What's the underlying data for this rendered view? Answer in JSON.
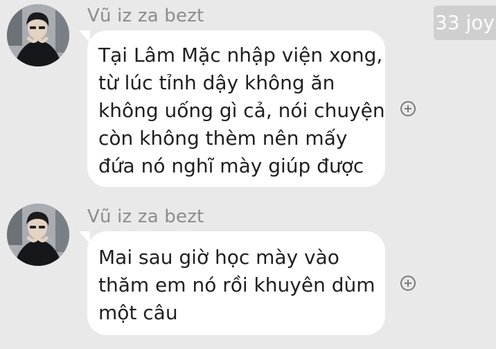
{
  "watermark": "33 joy",
  "messages": [
    {
      "sender": "Vũ iz za bezt",
      "lines": [
        "Tại Lâm Mặc nhập viện xong,",
        "từ lúc tỉnh dậy không ăn",
        "không uống gì cả, nói chuyện",
        "còn không thèm nên mấy",
        "đứa nó nghĩ mày giúp được"
      ]
    },
    {
      "sender": "Vũ iz za bezt",
      "lines": [
        "Mai sau giờ học mày vào",
        "thăm em nó rồi khuyên dùm",
        "một câu"
      ]
    }
  ],
  "icons": {
    "avatar": "avatar",
    "react": "add-reaction-icon"
  }
}
